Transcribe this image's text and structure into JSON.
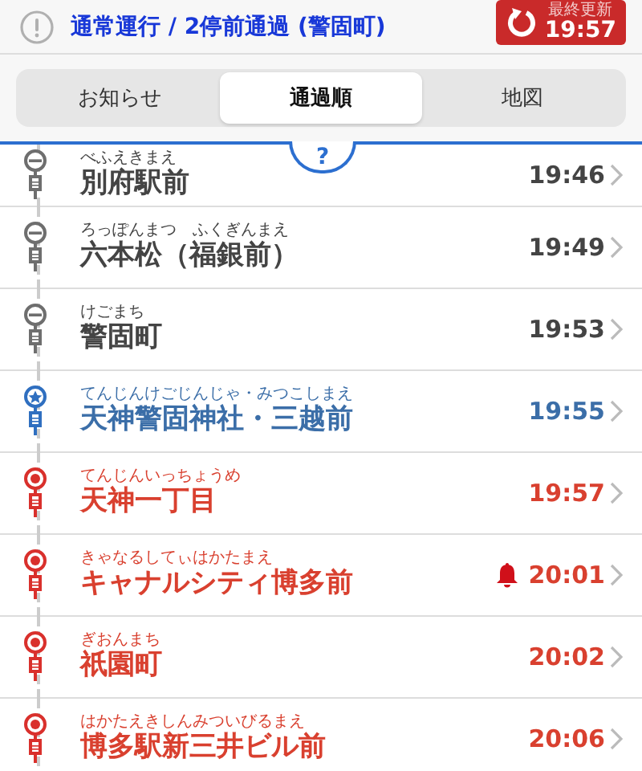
{
  "status_bar": {
    "message": "通常運行 / 2停前通過 (警固町)",
    "update_label": "最終更新",
    "update_time": "19:57"
  },
  "tabs": [
    {
      "label": "お知らせ",
      "selected": false
    },
    {
      "label": "通過順",
      "selected": true
    },
    {
      "label": "地図",
      "selected": false
    }
  ],
  "help_label": "?",
  "stops": [
    {
      "reading": "べふえきまえ",
      "name": "別府駅前",
      "time": "19:46",
      "kind": "passed",
      "alarm": false
    },
    {
      "reading": "ろっぽんまつ　ふくぎんまえ",
      "name": "六本松（福銀前）",
      "time": "19:49",
      "kind": "passed",
      "alarm": false
    },
    {
      "reading": "けごまち",
      "name": "警固町",
      "time": "19:53",
      "kind": "passed",
      "alarm": false
    },
    {
      "reading": "てんじんけごじんじゃ・みつこしまえ",
      "name": "天神警固神社・三越前",
      "time": "19:55",
      "kind": "current",
      "alarm": false
    },
    {
      "reading": "てんじんいっちょうめ",
      "name": "天神一丁目",
      "time": "19:57",
      "kind": "upcoming",
      "alarm": false
    },
    {
      "reading": "きゃなるしてぃはかたまえ",
      "name": "キャナルシティ博多前",
      "time": "20:01",
      "kind": "upcoming",
      "alarm": true
    },
    {
      "reading": "ぎおんまち",
      "name": "祇園町",
      "time": "20:02",
      "kind": "upcoming",
      "alarm": false
    },
    {
      "reading": "はかたえきしんみついびるまえ",
      "name": "博多駅新三井ビル前",
      "time": "20:06",
      "kind": "upcoming",
      "alarm": false
    }
  ]
}
